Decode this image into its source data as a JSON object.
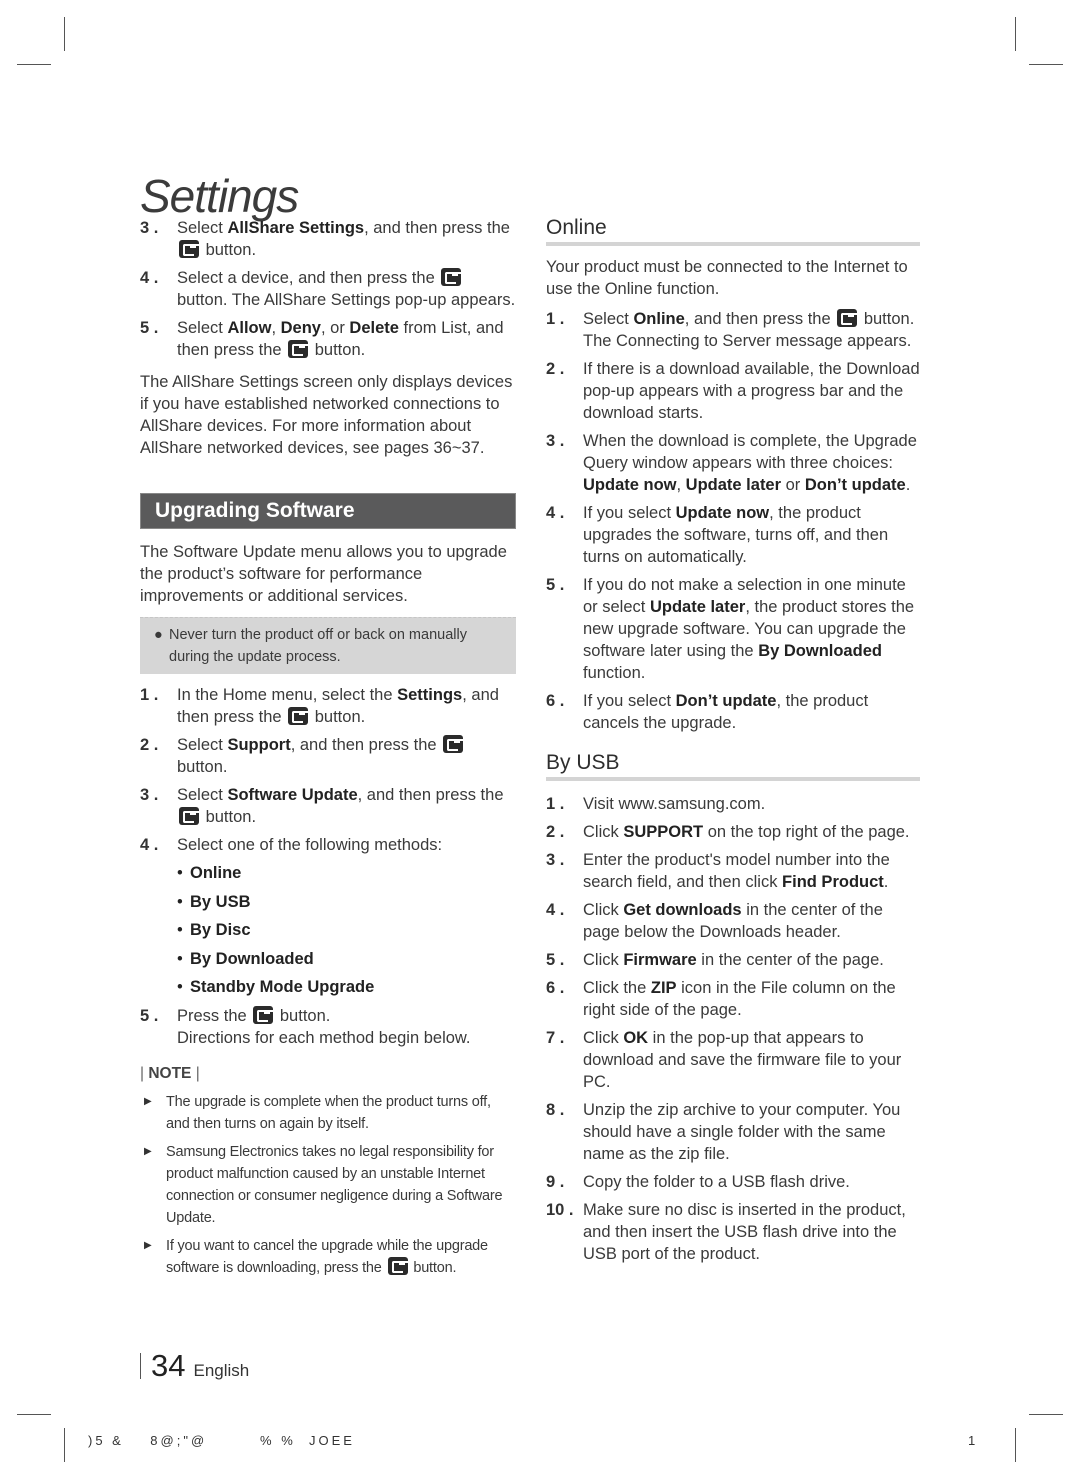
{
  "page": {
    "title": "Settings",
    "page_number": "34",
    "language": "English",
    "print_code": ")5 &    8@;\"@        % %  JOEE",
    "print_page": "1"
  },
  "left": {
    "top_steps": [
      {
        "num": "3 .",
        "parts": [
          {
            "t": "Select "
          },
          {
            "b": "AllShare Settings"
          },
          {
            "t": ", and then press the "
          },
          {
            "icon": "enter"
          },
          {
            "t": " button."
          }
        ]
      },
      {
        "num": "4 .",
        "parts": [
          {
            "t": "Select a device, and then press the "
          },
          {
            "icon": "enter"
          },
          {
            "t": " button. The AllShare Settings pop-up appears."
          }
        ]
      },
      {
        "num": "5 .",
        "parts": [
          {
            "t": "Select "
          },
          {
            "b": "Allow"
          },
          {
            "t": ", "
          },
          {
            "b": "Deny"
          },
          {
            "t": ", or "
          },
          {
            "b": "Delete"
          },
          {
            "t": " from List, and then press the "
          },
          {
            "icon": "enter"
          },
          {
            "t": " button."
          }
        ]
      }
    ],
    "allshare_note": "The AllShare Settings screen only displays devices if you have established networked connections to AllShare devices. For more information about AllShare networked devices, see pages 36~37.",
    "section_title": "Upgrading Software",
    "section_intro": "The Software Update menu allows you to upgrade the product’s software for performance improvements or additional services.",
    "warning": "Never turn the product off or back on manually during the update process.",
    "steps": [
      {
        "num": "1 .",
        "parts": [
          {
            "t": "In the Home menu, select the "
          },
          {
            "b": "Settings"
          },
          {
            "t": ", and then press the "
          },
          {
            "icon": "enter"
          },
          {
            "t": " button."
          }
        ]
      },
      {
        "num": "2 .",
        "parts": [
          {
            "t": "Select "
          },
          {
            "b": "Support"
          },
          {
            "t": ", and then press the "
          },
          {
            "icon": "enter"
          },
          {
            "t": " button."
          }
        ]
      },
      {
        "num": "3 .",
        "parts": [
          {
            "t": "Select "
          },
          {
            "b": "Software Update"
          },
          {
            "t": ", and then press the "
          },
          {
            "icon": "enter"
          },
          {
            "t": " button."
          }
        ]
      },
      {
        "num": "4 .",
        "parts": [
          {
            "t": "Select one of the following methods:"
          }
        ]
      }
    ],
    "methods": [
      "Online",
      "By USB",
      "By Disc",
      "By Downloaded",
      "Standby Mode Upgrade"
    ],
    "step5": {
      "num": "5 .",
      "parts": [
        {
          "t": "Press the "
        },
        {
          "icon": "enter"
        },
        {
          "t": " button."
        },
        {
          "br": true
        },
        {
          "t": "Directions for each method begin below."
        }
      ]
    },
    "note_label": "NOTE",
    "notes": [
      {
        "parts": [
          {
            "t": "The upgrade is complete when the product turns off, and then turns on again by itself."
          }
        ]
      },
      {
        "parts": [
          {
            "t": "Samsung Electronics takes no legal responsibility for product malfunction caused by an unstable Internet connection or consumer negligence during a Software Update."
          }
        ]
      },
      {
        "parts": [
          {
            "t": "If you want to cancel the upgrade while the upgrade software is downloading, press the "
          },
          {
            "icon": "enter"
          },
          {
            "t": " button."
          }
        ]
      }
    ]
  },
  "right": {
    "online": {
      "title": "Online",
      "intro": "Your product must be connected to the Internet to use the Online function.",
      "steps": [
        {
          "num": "1 .",
          "parts": [
            {
              "t": "Select "
            },
            {
              "b": "Online"
            },
            {
              "t": ", and then press the "
            },
            {
              "icon": "enter"
            },
            {
              "t": " button. The Connecting to Server message appears."
            }
          ]
        },
        {
          "num": "2 .",
          "parts": [
            {
              "t": "If there is a download available, the Download pop-up appears with a progress bar and the download starts."
            }
          ]
        },
        {
          "num": "3 .",
          "parts": [
            {
              "t": "When the download is complete, the Upgrade Query window appears with three choices: "
            },
            {
              "b": "Update now"
            },
            {
              "t": ", "
            },
            {
              "b": "Update later"
            },
            {
              "t": " or "
            },
            {
              "b": "Don’t update"
            },
            {
              "t": "."
            }
          ]
        },
        {
          "num": "4 .",
          "parts": [
            {
              "t": "If you select "
            },
            {
              "b": "Update now"
            },
            {
              "t": ", the product upgrades the software, turns off, and then turns on automatically."
            }
          ]
        },
        {
          "num": "5 .",
          "parts": [
            {
              "t": "If you do not make a selection in one minute or select "
            },
            {
              "b": "Update later"
            },
            {
              "t": ", the product stores the new upgrade software. You can upgrade the software later using the "
            },
            {
              "b": "By Downloaded"
            },
            {
              "t": " function."
            }
          ]
        },
        {
          "num": "6 .",
          "parts": [
            {
              "t": "If you select "
            },
            {
              "b": "Don’t update"
            },
            {
              "t": ", the product cancels the upgrade."
            }
          ]
        }
      ]
    },
    "usb": {
      "title": "By USB",
      "steps": [
        {
          "num": "1 .",
          "parts": [
            {
              "t": "Visit www.samsung.com."
            }
          ]
        },
        {
          "num": "2 .",
          "parts": [
            {
              "t": "Click "
            },
            {
              "b": "SUPPORT"
            },
            {
              "t": " on the top right of the page."
            }
          ]
        },
        {
          "num": "3 .",
          "parts": [
            {
              "t": "Enter the product's model number into the search field, and then click "
            },
            {
              "b": "Find Product"
            },
            {
              "t": "."
            }
          ]
        },
        {
          "num": "4 .",
          "parts": [
            {
              "t": "Click "
            },
            {
              "b": "Get downloads"
            },
            {
              "t": " in the center of the page below the Downloads header."
            }
          ]
        },
        {
          "num": "5 .",
          "parts": [
            {
              "t": "Click "
            },
            {
              "b": "Firmware"
            },
            {
              "t": " in the center of the page."
            }
          ]
        },
        {
          "num": "6 .",
          "parts": [
            {
              "t": "Click the "
            },
            {
              "b": "ZIP"
            },
            {
              "t": " icon in the File column on the right side of the page."
            }
          ]
        },
        {
          "num": "7 .",
          "parts": [
            {
              "t": "Click "
            },
            {
              "b": "OK"
            },
            {
              "t": " in the pop-up that appears to download and save the firmware file to your PC."
            }
          ]
        },
        {
          "num": "8 .",
          "parts": [
            {
              "t": "Unzip the zip archive to your computer. You should have a single folder with the same name as the zip file."
            }
          ]
        },
        {
          "num": "9 .",
          "parts": [
            {
              "t": "Copy the folder to a USB flash drive."
            }
          ]
        },
        {
          "num": "10 .",
          "parts": [
            {
              "t": "Make sure no disc is inserted in the product, and then insert the USB flash drive into the USB port of the product."
            }
          ]
        }
      ]
    }
  }
}
